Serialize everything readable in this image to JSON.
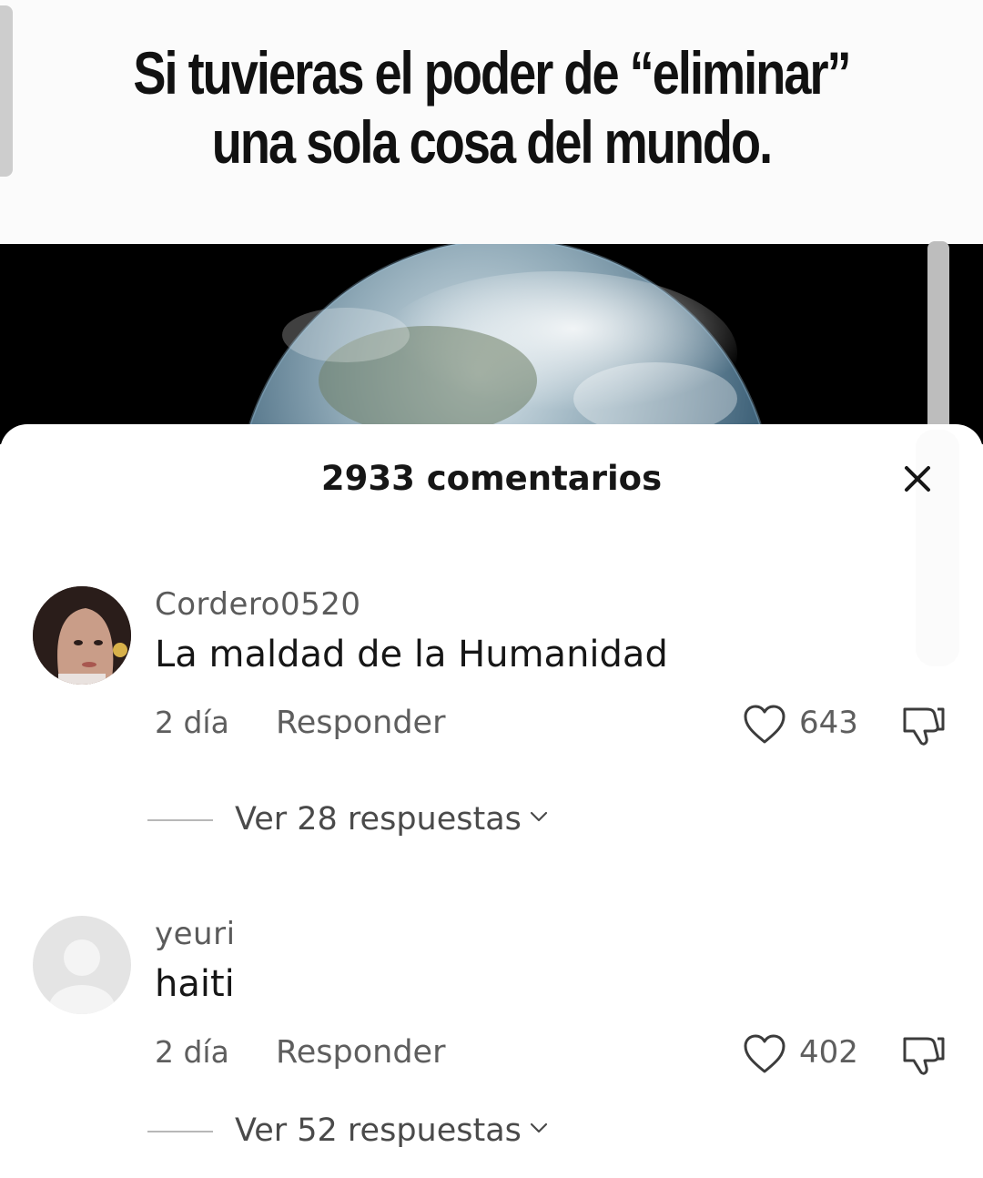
{
  "video": {
    "caption_line1": "Si tuvieras el poder de “eliminar”",
    "caption_line2": "una sola cosa del mundo."
  },
  "comments_sheet": {
    "title": "2933 comentarios",
    "close_icon": "close-icon",
    "comments": [
      {
        "username": "Cordero0520",
        "text": "La maldad de la Humanidad",
        "date": "2 día",
        "reply_label": "Responder",
        "likes": "643",
        "view_replies": "Ver 28 respuestas",
        "avatar": "user-photo"
      },
      {
        "username": "yeuri",
        "text": "haiti",
        "date": "2 día",
        "reply_label": "Responder",
        "likes": "402",
        "view_replies": "Ver 52 respuestas",
        "avatar": "default-avatar"
      }
    ]
  }
}
